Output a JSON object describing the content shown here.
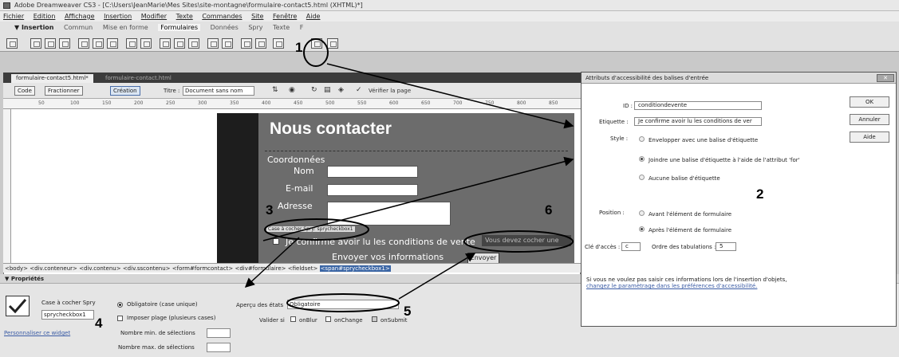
{
  "window": {
    "title": "Adobe Dreamweaver CS3 - [C:\\Users\\JeanMarie\\Mes Sites\\site-montagne\\formulaire-contact5.html (XHTML)*]"
  },
  "menu": [
    "Fichier",
    "Edition",
    "Affichage",
    "Insertion",
    "Modifier",
    "Texte",
    "Commandes",
    "Site",
    "Fenêtre",
    "Aide"
  ],
  "insert_bar": {
    "tabs": [
      "▼ Insertion",
      "Commun",
      "Mise en forme",
      "Formulaires",
      "Données",
      "Spry",
      "Texte",
      "F"
    ]
  },
  "doc": {
    "tabs": [
      "formulaire-contact5.html*",
      "formulaire-contact.html"
    ],
    "toolbar": {
      "code": "Code",
      "split": "Fractionner",
      "design": "Création",
      "title_label": "Titre :",
      "title_value": "Document sans nom",
      "check": "Vérifier la page"
    },
    "ruler": [
      "50",
      "100",
      "150",
      "200",
      "250",
      "300",
      "350",
      "400",
      "450",
      "500",
      "550",
      "600",
      "650",
      "700",
      "750",
      "800",
      "850"
    ],
    "page": {
      "heading": "Nous contacter",
      "fieldset": "Coordonnées",
      "nom": "Nom",
      "email": "E-mail",
      "adresse": "Adresse",
      "spry_tag": "Case à cocher Spry: sprycheckbox1",
      "checkbox_label": "Je confirme avoir lu les conditions de vente",
      "spry_msg": "Vous devez cocher une",
      "submit_text": "Envoyer vos informations",
      "submit_btn": "Envoyer"
    },
    "status": [
      "<body>",
      "<div.conteneur>",
      "<div.contenu>",
      "<div.sscontenu>",
      "<form#formcontact>",
      "<div#formulaire>",
      "<fieldset>"
    ],
    "status_selected": "<span#sprycheckbox1>"
  },
  "props": {
    "title": "▼ Propriétés",
    "widget_type": "Case à cocher Spry",
    "widget_name": "sprycheckbox1",
    "customize": "Personnaliser ce widget",
    "required": "Obligatoire (case unique)",
    "range": "Imposer plage (plusieurs cases)",
    "min": "Nombre min. de sélections",
    "max": "Nombre max. de sélections",
    "preview_label": "Aperçu des états",
    "preview_value": "Obligatoire",
    "validate_label": "Valider si",
    "onblur": "onBlur",
    "onchange": "onChange",
    "onsubmit": "onSubmit"
  },
  "dialog": {
    "title": "Attributs d'accessibilité des balises d'entrée",
    "id_label": "ID :",
    "id_value": "conditiondevente",
    "label_label": "Etiquette :",
    "label_value": "Je confirme avoir lu les conditions de ver",
    "style_label": "Style :",
    "style_opt1": "Envelopper avec une balise d'étiquette",
    "style_opt2": "Joindre une balise d'étiquette à l'aide de l'attribut 'for'",
    "style_opt3": "Aucune balise d'étiquette",
    "position_label": "Position :",
    "position_opt1": "Avant l'élément de formulaire",
    "position_opt2": "Après l'élément de formulaire",
    "access_label": "Clé d'accès :",
    "access_value": "c",
    "tab_label": "Ordre des tabulations :",
    "tab_value": "5",
    "note": "Si vous ne voulez pas saisir ces informations lors de l'insertion d'objets,",
    "note_link": "changez le paramètrage dans les préférences d'accessibilité.",
    "ok": "OK",
    "cancel": "Annuler",
    "help": "Aide"
  },
  "callouts": [
    "1",
    "2",
    "3",
    "4",
    "5",
    "6"
  ]
}
